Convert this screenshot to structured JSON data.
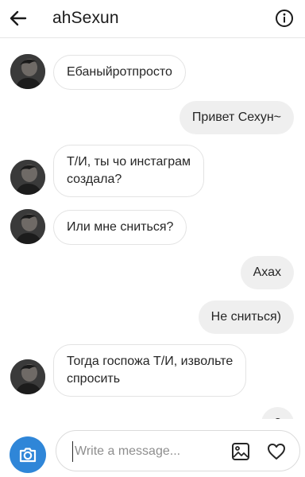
{
  "header": {
    "username": "ahSexun",
    "back_icon": "arrow-left-icon",
    "info_icon": "info-circle-icon"
  },
  "messages": [
    {
      "direction": "incoming",
      "text": "Ебаныйротпросто"
    },
    {
      "direction": "outgoing",
      "text": "Привет Сехун~"
    },
    {
      "direction": "incoming",
      "text_lines": [
        "Т/И, ты чо инстаграм",
        "создала?"
      ]
    },
    {
      "direction": "incoming",
      "text": "Или мне сниться?"
    },
    {
      "direction": "outgoing",
      "text": "Ахах"
    },
    {
      "direction": "outgoing",
      "text": "Не сниться)"
    },
    {
      "direction": "incoming",
      "text_lines": [
        "Тогда госпожа Т/И, извольте",
        "спросить"
      ]
    },
    {
      "direction": "outgoing",
      "text": "?"
    }
  ],
  "composer": {
    "placeholder": "Write a message...",
    "value": "",
    "camera_icon": "camera-icon",
    "gallery_icon": "gallery-icon",
    "like_icon": "heart-icon"
  },
  "colors": {
    "camera_button": "#2f86d8",
    "outgoing_bubble": "#efefef",
    "incoming_border": "#e3e3e3"
  }
}
